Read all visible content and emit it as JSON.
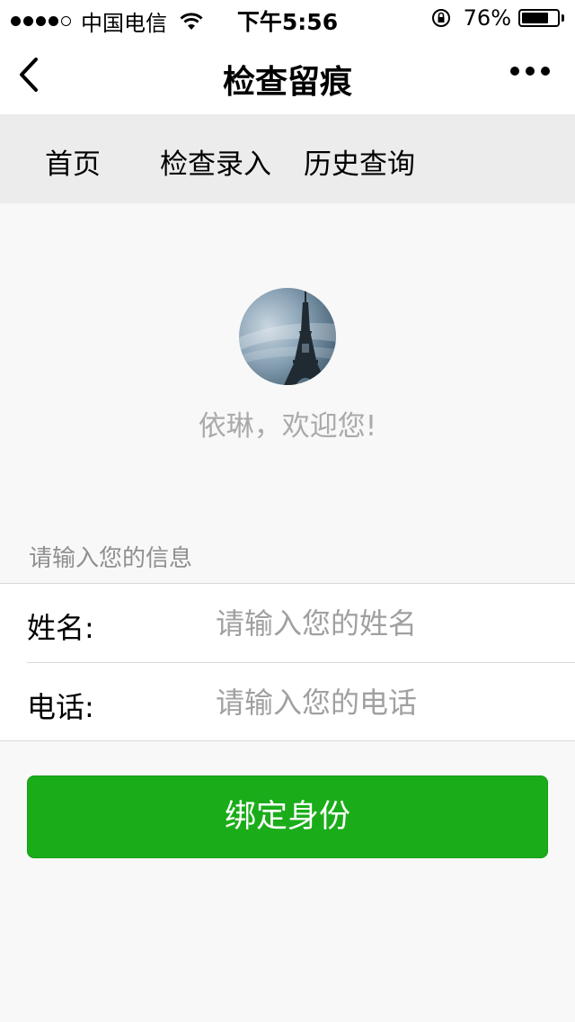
{
  "status_bar": {
    "carrier": "中国电信",
    "time": "下午5:56",
    "battery_percent": "76%",
    "battery_level": 0.76,
    "signal_bars_filled": 4,
    "signal_bars_total": 5
  },
  "nav": {
    "title": "检查留痕",
    "back_icon": "chevron-left-icon",
    "more_icon": "more-dots-icon"
  },
  "tabs": [
    {
      "label": "首页"
    },
    {
      "label": "检查录入"
    },
    {
      "label": "历史查询"
    }
  ],
  "profile": {
    "avatar_icon": "eiffel-tower-avatar",
    "welcome_text": "依琳，欢迎您!"
  },
  "form": {
    "hint": "请输入您的信息",
    "name_label": "姓名:",
    "name_placeholder": "请输入您的姓名",
    "phone_label": "电话:",
    "phone_placeholder": "请输入您的电话"
  },
  "button": {
    "label": "绑定身份",
    "color": "#1aad19"
  }
}
